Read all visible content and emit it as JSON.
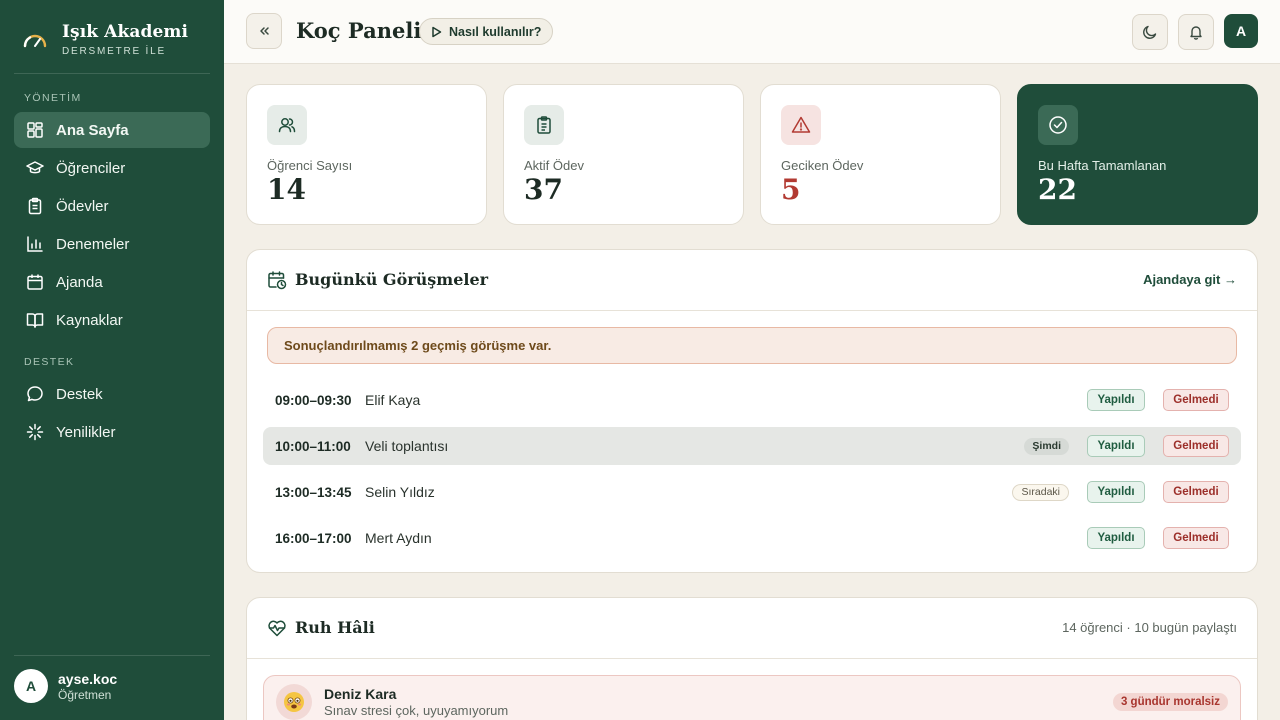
{
  "brand": {
    "title": "Işık Akademi",
    "subtitle": "DERSMETRE İLE"
  },
  "sidebar": {
    "section_manage": "YÖNETİM",
    "section_support": "DESTEK",
    "items": [
      {
        "label": "Ana Sayfa",
        "icon": "dashboard-icon",
        "active": true
      },
      {
        "label": "Öğrenciler",
        "icon": "graduation-cap-icon"
      },
      {
        "label": "Ödevler",
        "icon": "clipboard-icon"
      },
      {
        "label": "Denemeler",
        "icon": "bar-chart-icon"
      },
      {
        "label": "Ajanda",
        "icon": "calendar-icon"
      },
      {
        "label": "Kaynaklar",
        "icon": "book-icon"
      }
    ],
    "support_items": [
      {
        "label": "Destek",
        "icon": "chat-bubble-icon"
      },
      {
        "label": "Yenilikler",
        "icon": "sparkle-icon"
      }
    ]
  },
  "user": {
    "initial": "A",
    "name": "ayse.koc",
    "role": "Öğretmen"
  },
  "header": {
    "title": "Koç Paneli",
    "help_label": "Nasıl kullanılır?",
    "avatar_initial": "A"
  },
  "stats": [
    {
      "label": "Öğrenci Sayısı",
      "value": "14",
      "icon": "users-icon"
    },
    {
      "label": "Aktif Ödev",
      "value": "37",
      "icon": "clipboard-icon"
    },
    {
      "label": "Geciken Ödev",
      "value": "5",
      "icon": "warning-icon"
    },
    {
      "label": "Bu Hafta Tamamlanan",
      "value": "22",
      "icon": "check-circle-icon"
    }
  ],
  "meetings": {
    "title": "Bugünkü Görüşmeler",
    "link": "Ajandaya git →",
    "alert": "Sonuçlandırılmamış 2 geçmiş görüşme var.",
    "done_label": "Yapıldı",
    "missed_label": "Gelmedi",
    "rows": [
      {
        "time": "09:00–09:30",
        "name": "Elif Kaya",
        "tag": ""
      },
      {
        "time": "10:00–11:00",
        "name": "Veli toplantısı",
        "tag": "Şimdi"
      },
      {
        "time": "13:00–13:45",
        "name": "Selin Yıldız",
        "tag": "Sıradaki"
      },
      {
        "time": "16:00–17:00",
        "name": "Mert Aydın",
        "tag": ""
      }
    ]
  },
  "mood": {
    "title": "Ruh Hâli",
    "meta": "14 öğrenci · 10 bugün paylaştı",
    "entries": [
      {
        "name": "Deniz Kara",
        "note": "Sınav stresi çok, uyuyamıyorum",
        "tag": "3 gündür moralsiz",
        "emoji": "anxious-face-icon"
      }
    ]
  },
  "colors": {
    "primary": "#1f4d3a",
    "background": "#f3efe7",
    "danger": "#b23a32"
  }
}
